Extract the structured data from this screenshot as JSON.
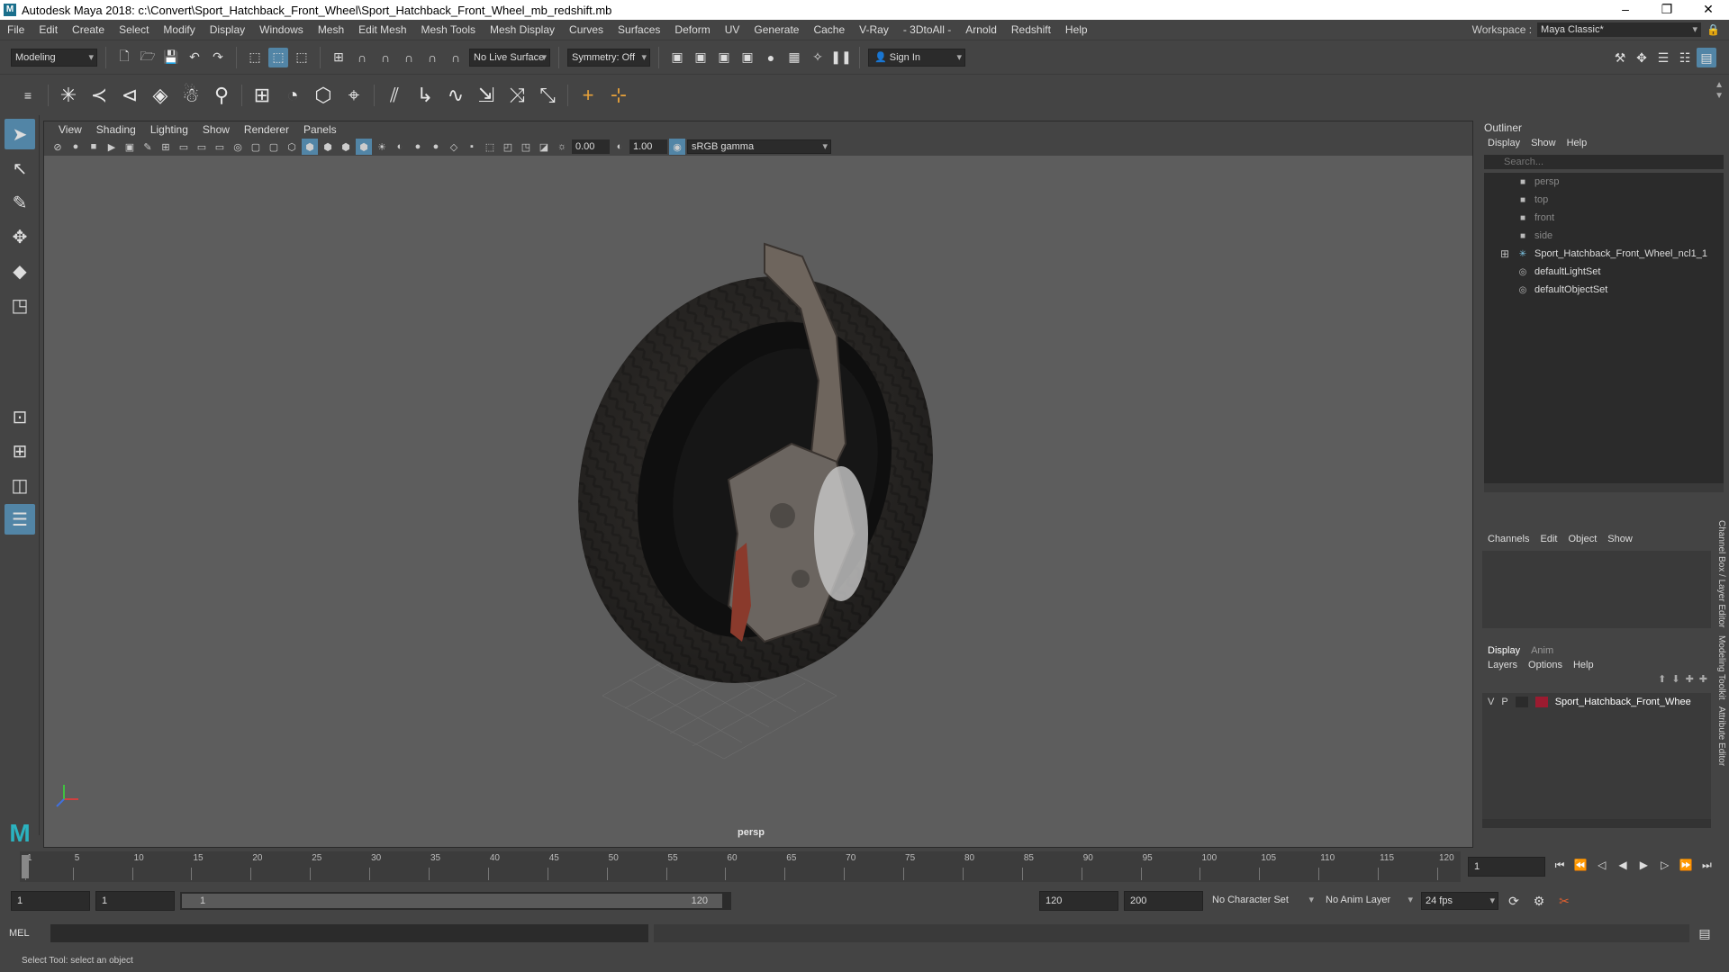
{
  "window": {
    "title": "Autodesk Maya 2018: c:\\Convert\\Sport_Hatchback_Front_Wheel\\Sport_Hatchback_Front_Wheel_mb_redshift.mb",
    "minimize": "–",
    "maximize": "❐",
    "close": "✕"
  },
  "menubar": {
    "items": [
      "File",
      "Edit",
      "Create",
      "Select",
      "Modify",
      "Display",
      "Windows",
      "Mesh",
      "Edit Mesh",
      "Mesh Tools",
      "Mesh Display",
      "Curves",
      "Surfaces",
      "Deform",
      "UV",
      "Generate",
      "Cache",
      "V-Ray",
      "- 3DtoAll -",
      "Arnold",
      "Redshift",
      "Help"
    ],
    "workspace_label": "Workspace :",
    "workspace_value": "Maya Classic*"
  },
  "statusline": {
    "mode": "Modeling",
    "live_surface": "No Live Surface",
    "symmetry": "Symmetry: Off",
    "sign_in": "Sign In"
  },
  "panel": {
    "menus": [
      "View",
      "Shading",
      "Lighting",
      "Show",
      "Renderer",
      "Panels"
    ],
    "exposure": "0.00",
    "gamma": "1.00",
    "color_space": "sRGB gamma",
    "camera_label": "persp"
  },
  "outliner": {
    "title": "Outliner",
    "menus": [
      "Display",
      "Show",
      "Help"
    ],
    "search_placeholder": "Search...",
    "items": [
      {
        "label": "persp",
        "dim": true
      },
      {
        "label": "top",
        "dim": true
      },
      {
        "label": "front",
        "dim": true
      },
      {
        "label": "side",
        "dim": true
      },
      {
        "label": "Sport_Hatchback_Front_Wheel_ncl1_1",
        "dim": false
      },
      {
        "label": "defaultLightSet",
        "dim": false
      },
      {
        "label": "defaultObjectSet",
        "dim": false
      }
    ]
  },
  "channelbox": {
    "menus": [
      "Channels",
      "Edit",
      "Object",
      "Show"
    ]
  },
  "layereditor": {
    "tabs": [
      "Display",
      "Anim"
    ],
    "menus": [
      "Layers",
      "Options",
      "Help"
    ],
    "layer": {
      "v": "V",
      "p": "P",
      "name": "Sport_Hatchback_Front_Whee",
      "color": "#9b1b30"
    }
  },
  "sidetabs": [
    "Channel Box / Layer Editor",
    "Modeling Toolkit",
    "Attribute Editor"
  ],
  "timeslider": {
    "ticks": [
      "1",
      "5",
      "10",
      "15",
      "20",
      "25",
      "30",
      "35",
      "40",
      "45",
      "50",
      "55",
      "60",
      "65",
      "70",
      "75",
      "80",
      "85",
      "90",
      "95",
      "100",
      "105",
      "110",
      "115",
      "120"
    ],
    "current_frame": "1"
  },
  "rangeslider": {
    "start": "1",
    "anim_start": "1",
    "range_start": "1",
    "range_end": "120",
    "end": "120",
    "anim_end": "200",
    "character_set": "No Character Set",
    "anim_layer": "No Anim Layer",
    "fps": "24 fps"
  },
  "cmdline": {
    "label": "MEL"
  },
  "helpline": {
    "text": "Select Tool: select an object"
  }
}
